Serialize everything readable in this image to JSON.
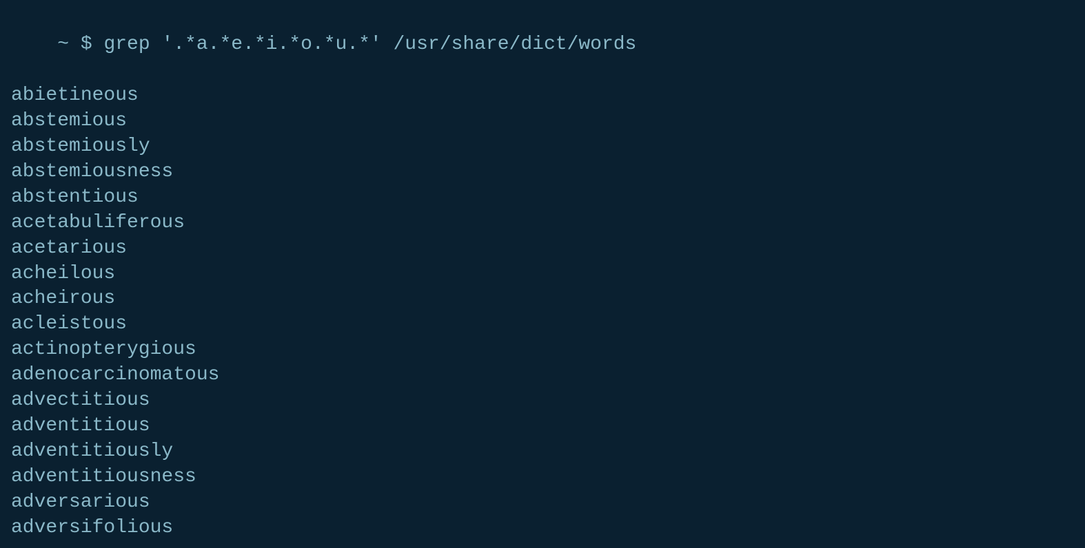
{
  "terminal": {
    "prompt": "~ $ ",
    "command": "grep '.\\*a.\\*e.\\*i.\\*o.\\*u.\\*' /usr/share/dict/words",
    "command_display": "grep '.*a.*e.*i.*o.*u.*' /usr/share/dict/words",
    "words": [
      "abietineous",
      "abstemious",
      "abstemiously",
      "abstemiousness",
      "abstentious",
      "acetabuliferous",
      "acetarious",
      "acheilous",
      "acheirous",
      "acleistous",
      "actinopterygious",
      "adenocarcinomatous",
      "advectitious",
      "adventitious",
      "adventitiously",
      "adventitiousness",
      "adversarious",
      "adversifolious"
    ]
  }
}
